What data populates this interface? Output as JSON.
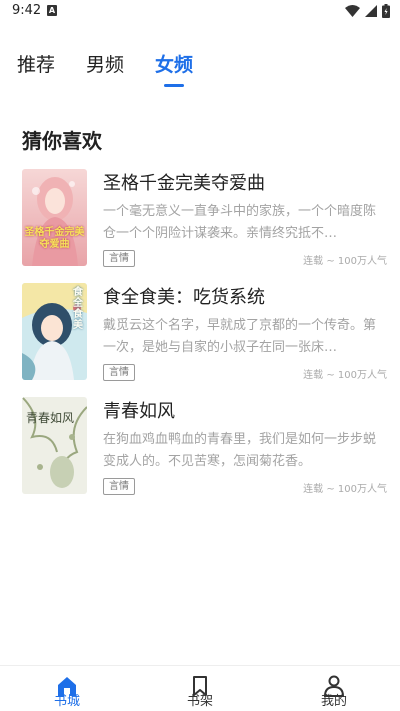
{
  "status_bar": {
    "time": "9:42",
    "notification_icon": "a-letter-notification-icon",
    "icons": [
      "wifi-icon",
      "signal-icon",
      "battery-icon"
    ]
  },
  "tabs": [
    {
      "label": "推荐",
      "active": false
    },
    {
      "label": "男频",
      "active": false
    },
    {
      "label": "女频",
      "active": true
    }
  ],
  "section_title": "猜你喜欢",
  "books": [
    {
      "title": "圣格千金完美夺爱曲",
      "description": "一个毫无意义一直争斗中的家族，一个个暗度陈仓一个个阴险计谋袭来。亲情终究抵不…",
      "tag": "言情",
      "meta": "连载 ~ 100万人气",
      "cover_text": "圣格千金完美夺爱曲",
      "cover_colors": [
        "#f3c7c9",
        "#e9a3a7"
      ]
    },
    {
      "title": "食全食美：吃货系统",
      "description": "戴觅云这个名字，早就成了京都的一个传奇。第一次，是她与自家的小叔子在同一张床…",
      "tag": "言情",
      "meta": "连载 ~ 100万人气",
      "cover_text": "食全食美",
      "cover_colors": [
        "#bfe3ea",
        "#3c6f8a"
      ]
    },
    {
      "title": "青春如风",
      "description": "在狗血鸡血鸭血的青春里，我们是如何一步步蜕变成人的。不见苦寒，怎闻菊花香。",
      "tag": "言情",
      "meta": "连载 ~ 100万人气",
      "cover_text": "青春如风",
      "cover_colors": [
        "#e9eadf",
        "#b8c1a4"
      ]
    }
  ],
  "bottom_nav": [
    {
      "label": "书城",
      "icon": "home-icon",
      "active": true
    },
    {
      "label": "书架",
      "icon": "bookmark-icon",
      "active": false
    },
    {
      "label": "我的",
      "icon": "user-icon",
      "active": false
    }
  ],
  "colors": {
    "accent": "#1e6fe8",
    "text": "#222222",
    "muted": "#a3a3a3"
  }
}
